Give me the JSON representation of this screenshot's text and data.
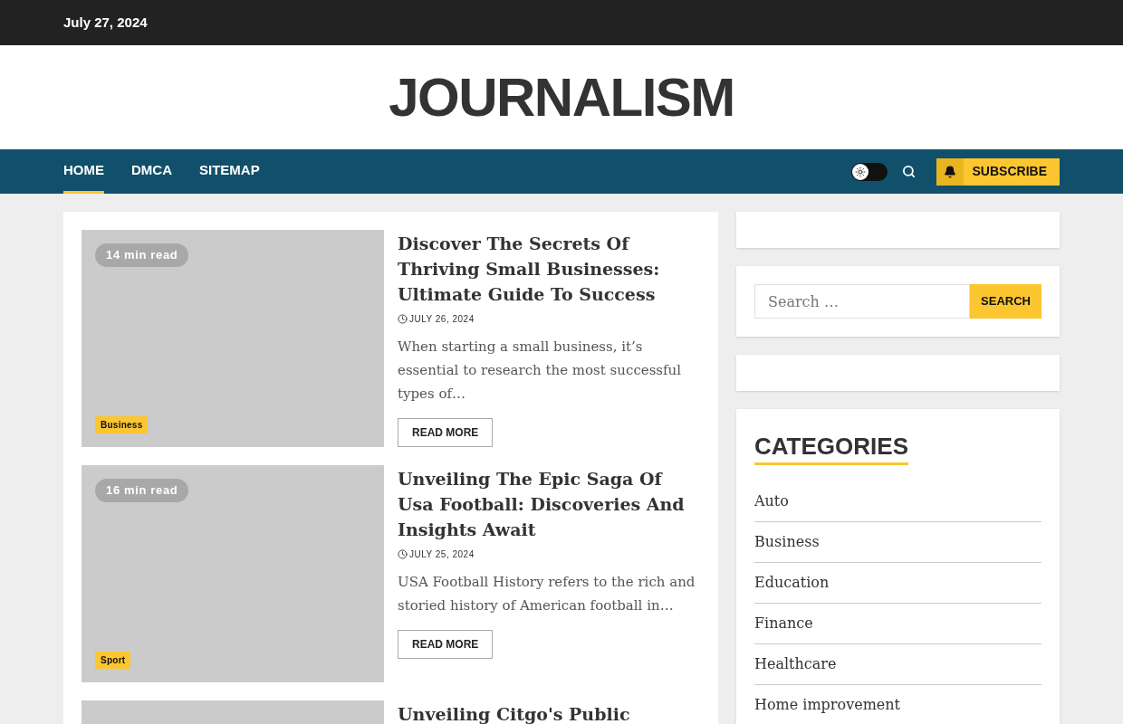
{
  "top_bar": {
    "date": "July 27, 2024"
  },
  "site_title": "JOURNALISM",
  "nav": {
    "items": [
      {
        "label": "HOME",
        "selected": true
      },
      {
        "label": "DMCA",
        "selected": false
      },
      {
        "label": "SITEMAP",
        "selected": false
      }
    ],
    "dark_mode": false,
    "subscribe": "SUBSCRIBE"
  },
  "articles": [
    {
      "read_time": "14 min read",
      "category": "Business",
      "title": "Discover The Secrets Of Thriving Small Businesses: Ultimate Guide To Success",
      "date": "JULY 26, 2024",
      "excerpt": "When starting a small business, it’s essential to research the most successful types of…",
      "button": "READ MORE"
    },
    {
      "read_time": "16 min read",
      "category": "Sport",
      "title": "Unveiling The Epic Saga Of Usa Football: Discoveries And Insights Await",
      "date": "JULY 25, 2024",
      "excerpt": "USA Football History refers to the rich and storied history of American football in…",
      "button": "READ MORE"
    },
    {
      "title": "Unveiling Citgo's Public"
    }
  ],
  "search": {
    "placeholder": "Search …",
    "button": "SEARCH"
  },
  "categories": {
    "heading": "CATEGORIES",
    "items": [
      "Auto",
      "Business",
      "Education",
      "Finance",
      "Healthcare",
      "Home improvement"
    ]
  }
}
